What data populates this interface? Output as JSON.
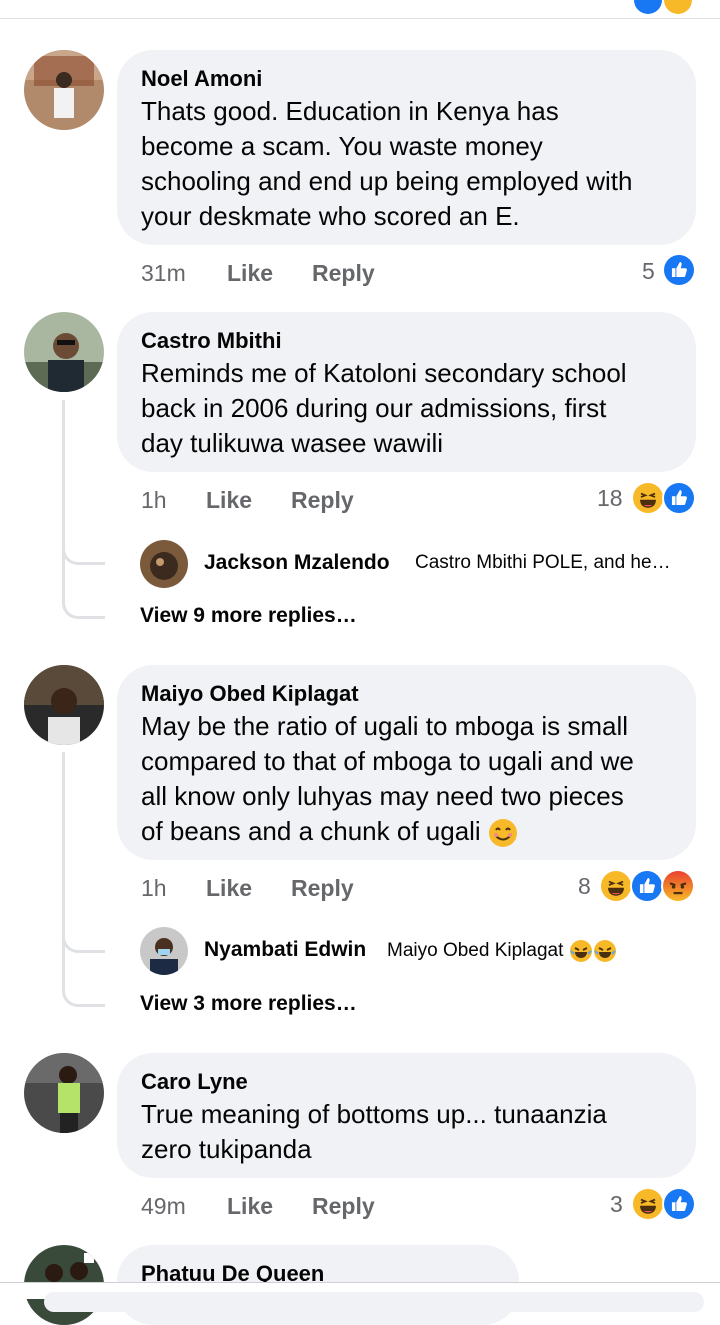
{
  "comments": [
    {
      "name": "Noel Amoni",
      "lines": [
        "Thats good. Education in Kenya has",
        "become a scam. You waste money",
        "schooling and end up being employed with",
        "your deskmate who scored an E."
      ],
      "time": "31m",
      "like": "Like",
      "reply": "Reply",
      "count": "5",
      "reactions": [
        "like-icon"
      ]
    },
    {
      "name": "Castro Mbithi",
      "lines": [
        "Reminds me of Katoloni secondary school",
        "back in 2006 during our admissions, first",
        "day tulikuwa wasee wawili"
      ],
      "time": "1h",
      "like": "Like",
      "reply": "Reply",
      "count": "18",
      "reactions": [
        "haha-icon",
        "like-icon"
      ],
      "reply_preview": {
        "name": "Jackson Mzalendo",
        "text": "Castro Mbithi POLE, and he…"
      },
      "view_more": "View 9 more replies…"
    },
    {
      "name": "Maiyo Obed Kiplagat",
      "lines": [
        "May be the ratio of ugali to mboga is small",
        "compared to that of mboga to ugali and we",
        "all know only luhyas may need two pieces",
        "of beans and a chunk of ugali"
      ],
      "time": "1h",
      "like": "Like",
      "reply": "Reply",
      "count": "8",
      "reactions": [
        "haha-icon",
        "like-icon",
        "angry-icon"
      ],
      "reply_preview": {
        "name": "Nyambati Edwin",
        "text": "Maiyo Obed Kiplagat"
      },
      "view_more": "View 3 more replies…"
    },
    {
      "name": "Caro Lyne",
      "lines": [
        "True meaning of bottoms up... tunaanzia",
        "zero tukipanda"
      ],
      "time": "49m",
      "like": "Like",
      "reply": "Reply",
      "count": "3",
      "reactions": [
        "haha-icon",
        "like-icon"
      ]
    },
    {
      "name": "Phatuu De Queen"
    }
  ],
  "colors": {
    "bubble": "#f0f2f5",
    "like_blue": "#1877f2",
    "meta_gray": "#65676b",
    "haha_yellow": "#f7b928",
    "angry_red": "#e9710f"
  }
}
